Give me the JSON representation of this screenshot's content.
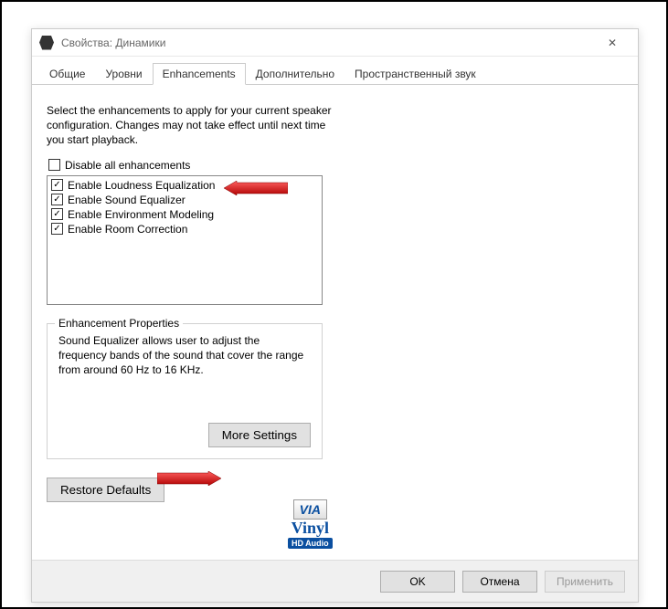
{
  "window": {
    "title": "Свойства: Динамики"
  },
  "tabs": {
    "general": "Общие",
    "levels": "Уровни",
    "enhancements": "Enhancements",
    "advanced": "Дополнительно",
    "spatial": "Пространственный звук"
  },
  "description": "Select the enhancements to apply for your current speaker configuration. Changes may not take effect until next time you start playback.",
  "disable_all": {
    "label": "Disable all enhancements",
    "checked": false
  },
  "enhancements": [
    {
      "label": "Enable Loudness Equalization",
      "checked": true
    },
    {
      "label": "Enable Sound Equalizer",
      "checked": true
    },
    {
      "label": "Enable Environment Modeling",
      "checked": true
    },
    {
      "label": "Enable Room Correction",
      "checked": true
    }
  ],
  "properties": {
    "legend": "Enhancement Properties",
    "text": "Sound Equalizer allows user to adjust the frequency bands of the sound that cover the range from around 60 Hz to 16 KHz.",
    "more": "More Settings"
  },
  "restore": "Restore Defaults",
  "logo": {
    "brand": "VIA",
    "line2": "Vinyl",
    "line3": "HD Audio"
  },
  "footer": {
    "ok": "OK",
    "cancel": "Отмена",
    "apply": "Применить"
  }
}
